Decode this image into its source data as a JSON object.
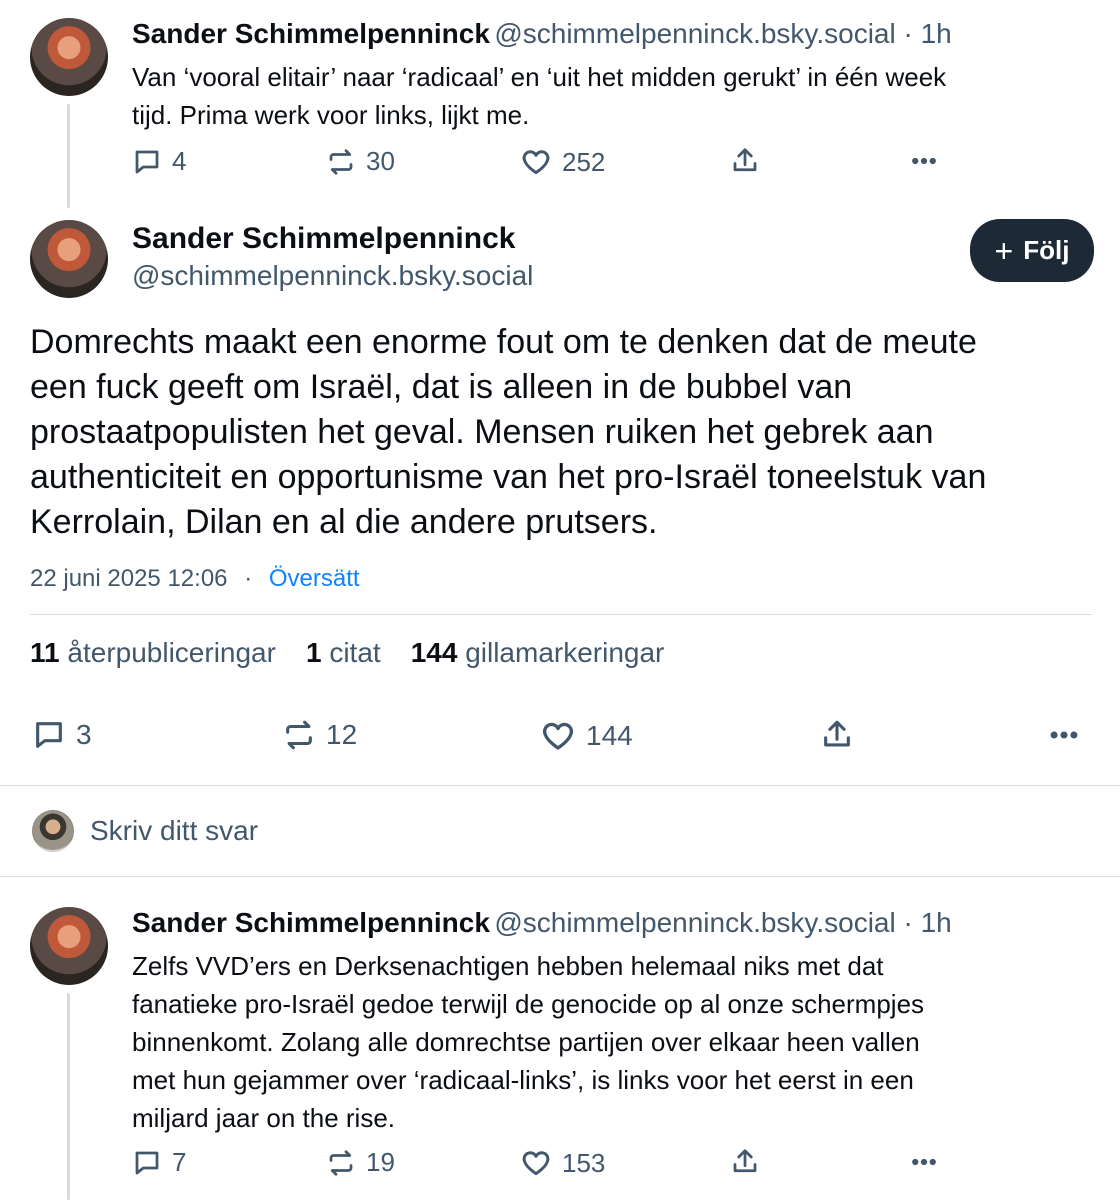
{
  "posts": [
    {
      "author": "Sander Schimmelpenninck",
      "handle_time": "@schimmelpenninck.bsky.social · 1h",
      "text_lines": [
        "Van ‘vooral elitair’ naar ‘radicaal’ en ‘uit het midden gerukt’ in één week",
        "tijd. Prima werk voor links, lijkt me."
      ],
      "replies": "4",
      "reposts": "30",
      "likes": "252"
    }
  ],
  "main_post": {
    "author": "Sander Schimmelpenninck",
    "handle": "@schimmelpenninck.bsky.social",
    "follow_label": "Följ",
    "text_lines": [
      "Domrechts maakt een enorme fout om te denken dat de meute",
      "een fuck geeft om Israël, dat is alleen in de bubbel van",
      "prostaatpopulisten het geval. Mensen ruiken het gebrek aan",
      "authenticiteit en opportunisme van het pro-Israël toneelstuk van",
      "Kerrolain, Dilan en al die andere prutsers."
    ],
    "date": "22 juni 2025 12:06",
    "translate": "Översätt",
    "stats": {
      "reposts_count": "11",
      "reposts_label": "återpubliceringar",
      "quotes_count": "1",
      "quotes_label": "citat",
      "likes_count": "144",
      "likes_label": "gillamarkeringar"
    },
    "replies": "3",
    "reposts": "12",
    "likes": "144"
  },
  "reply_box": {
    "placeholder": "Skriv ditt svar"
  },
  "reply_post": {
    "author": "Sander Schimmelpenninck",
    "handle_time": "@schimmelpenninck.bsky.social · 1h",
    "text_lines": [
      "Zelfs VVD’ers en Derksenachtigen hebben helemaal niks met dat",
      "fanatieke pro-Israël gedoe terwijl de genocide op al onze schermpjes",
      "binnenkomt. Zolang alle domrechtse partijen over elkaar heen vallen",
      "met hun gejammer over ‘radicaal-links’, is links voor het eerst in een",
      "miljard jaar on the rise."
    ],
    "replies": "7",
    "reposts": "19",
    "likes": "153"
  },
  "icons": {
    "reply": "speech-bubble-icon",
    "repost": "repost-arrows-icon",
    "like": "heart-icon",
    "share": "share-icon",
    "more": "more-dots-icon",
    "follow": "plus-icon"
  },
  "colors": {
    "text": "#0b0f14",
    "secondary": "#42576c",
    "link": "#1083fe",
    "follow_button": "#1e2936",
    "divider": "#d4dbe2"
  }
}
